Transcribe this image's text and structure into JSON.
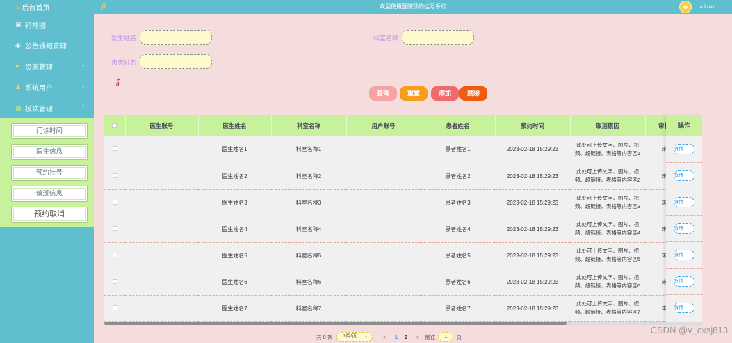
{
  "header": {
    "welcome": "欢迎使用医院预约挂号系统",
    "user": "admin"
  },
  "sidebar": {
    "home": "后台首页",
    "items": [
      {
        "label": "轮播图",
        "icon": "carousel-icon"
      },
      {
        "label": "公告通知管理",
        "icon": "notice-icon"
      },
      {
        "label": "资源管理",
        "icon": "resource-icon"
      },
      {
        "label": "系统用户",
        "icon": "user-icon"
      },
      {
        "label": "模块管理",
        "icon": "module-icon"
      }
    ],
    "submenu": [
      "门诊时间",
      "医生信息",
      "预约挂号",
      "值班信息",
      "预约取消"
    ]
  },
  "search": {
    "doctor_label": "医生姓名",
    "dept_label": "科室名称",
    "patient_label": "患者姓名",
    "doctor_value": "",
    "dept_value": "",
    "patient_value": ""
  },
  "actions": {
    "query": "查询",
    "reset": "重置",
    "add": "添加",
    "delete": "删除"
  },
  "table": {
    "columns": [
      "医生账号",
      "医生姓名",
      "科室名称",
      "用户账号",
      "患者姓名",
      "预约时间",
      "取消原因",
      "审核状态"
    ],
    "op_column": "操作",
    "detail_label": "详情",
    "rows": [
      {
        "doctor_account": "",
        "doctor": "医生姓名1",
        "dept": "科室名称1",
        "user_account": "",
        "patient": "患者姓名1",
        "time": "2023-02-18 15:29:23",
        "reason": "此处可上传文字、图片、视频、超链接、表格等内容区1",
        "status": "未审核"
      },
      {
        "doctor_account": "",
        "doctor": "医生姓名2",
        "dept": "科室名称2",
        "user_account": "",
        "patient": "患者姓名2",
        "time": "2023-02-18 15:29:23",
        "reason": "此处可上传文字、图片、视频、超链接、表格等内容区2",
        "status": "未审核"
      },
      {
        "doctor_account": "",
        "doctor": "医生姓名3",
        "dept": "科室名称3",
        "user_account": "",
        "patient": "患者姓名3",
        "time": "2023-02-18 15:29:23",
        "reason": "此处可上传文字、图片、视频、超链接、表格等内容区3",
        "status": "未审核"
      },
      {
        "doctor_account": "",
        "doctor": "医生姓名4",
        "dept": "科室名称4",
        "user_account": "",
        "patient": "患者姓名4",
        "time": "2023-02-18 15:29:23",
        "reason": "此处可上传文字、图片、视频、超链接、表格等内容区4",
        "status": "未审核"
      },
      {
        "doctor_account": "",
        "doctor": "医生姓名5",
        "dept": "科室名称5",
        "user_account": "",
        "patient": "患者姓名5",
        "time": "2023-02-18 15:29:23",
        "reason": "此处可上传文字、图片、视频、超链接、表格等内容区5",
        "status": "未审核"
      },
      {
        "doctor_account": "",
        "doctor": "医生姓名6",
        "dept": "科室名称6",
        "user_account": "",
        "patient": "患者姓名6",
        "time": "2023-02-18 15:29:23",
        "reason": "此处可上传文字、图片、视频、超链接、表格等内容区6",
        "status": "未审核"
      },
      {
        "doctor_account": "",
        "doctor": "医生姓名7",
        "dept": "科室名称7",
        "user_account": "",
        "patient": "患者姓名7",
        "time": "2023-02-18 15:29:23",
        "reason": "此处可上传文字、图片、视频、超链接、表格等内容区7",
        "status": "未审核"
      }
    ]
  },
  "pagination": {
    "total": "共 8 条",
    "page_size": "7条/页",
    "pages": [
      "1",
      "2"
    ],
    "prev": "<",
    "next": ">",
    "goto_label": "前往",
    "goto_value": "1",
    "page_unit": "页"
  },
  "watermark": "CSDN @v_cxsj813"
}
